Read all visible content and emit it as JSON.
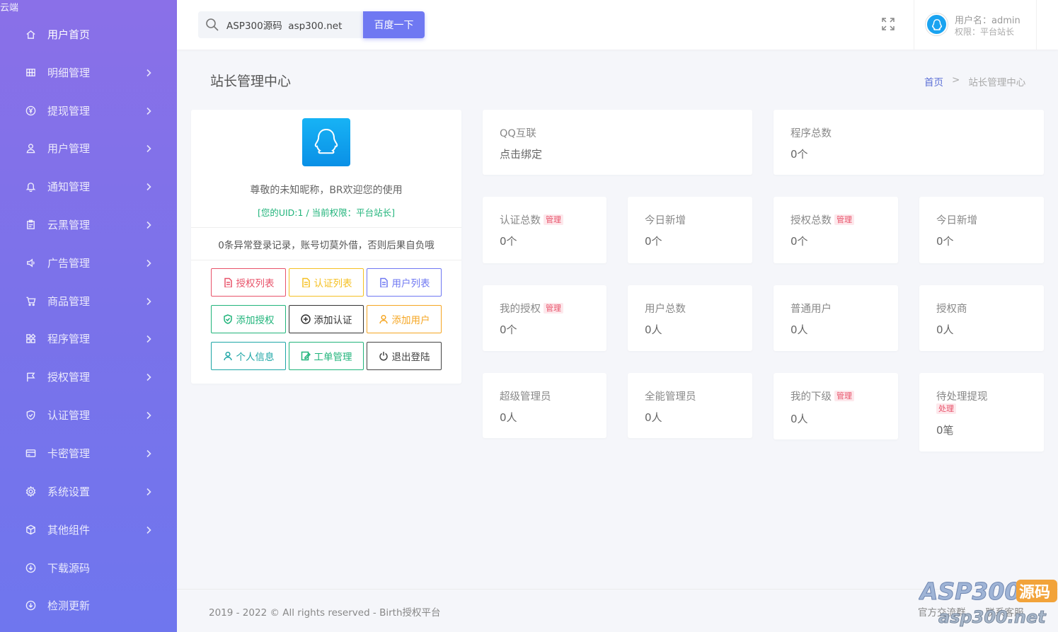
{
  "brand": "云端",
  "sidebar": {
    "items": [
      {
        "label": "用户首页",
        "icon": "home-icon"
      },
      {
        "label": "明细管理",
        "icon": "grid-icon"
      },
      {
        "label": "提现管理",
        "icon": "yen-icon"
      },
      {
        "label": "用户管理",
        "icon": "user-icon"
      },
      {
        "label": "通知管理",
        "icon": "bell-icon"
      },
      {
        "label": "云黑管理",
        "icon": "clipboard-icon"
      },
      {
        "label": "广告管理",
        "icon": "speaker-icon"
      },
      {
        "label": "商品管理",
        "icon": "cart-icon"
      },
      {
        "label": "程序管理",
        "icon": "apps-icon"
      },
      {
        "label": "授权管理",
        "icon": "flag-icon"
      },
      {
        "label": "认证管理",
        "icon": "shield-icon"
      },
      {
        "label": "卡密管理",
        "icon": "card-icon"
      },
      {
        "label": "系统设置",
        "icon": "gear-icon"
      },
      {
        "label": "其他组件",
        "icon": "box-icon"
      },
      {
        "label": "下载源码",
        "icon": "download-icon"
      },
      {
        "label": "检测更新",
        "icon": "update-icon"
      }
    ]
  },
  "header": {
    "search_value": "ASP300源码  asp300.net",
    "search_button": "百度一下",
    "username": "用户名：admin",
    "role": "权限：平台站长"
  },
  "page": {
    "title": "站长管理中心",
    "breadcrumb_home": "首页",
    "breadcrumb_sep": ">",
    "breadcrumb_current": "站长管理中心"
  },
  "profile": {
    "welcome": "尊敬的未知昵称，BR欢迎您的使用",
    "uid_line": "[您的UID:1 / 当前权限：平台站长]",
    "warning": "0条异常登录记录，账号切莫外借，否则后果自负哦",
    "buttons": [
      {
        "label": "授权列表",
        "color": "#e8536a",
        "icon": "doc-icon"
      },
      {
        "label": "认证列表",
        "color": "#f5c023",
        "icon": "doc-icon"
      },
      {
        "label": "用户列表",
        "color": "#6f78f2",
        "icon": "doc-icon"
      },
      {
        "label": "添加授权",
        "color": "#21b47b",
        "icon": "shield-check-icon"
      },
      {
        "label": "添加认证",
        "color": "#333333",
        "icon": "plus-circle-icon"
      },
      {
        "label": "添加用户",
        "color": "#f5a623",
        "icon": "user-icon"
      },
      {
        "label": "个人信息",
        "color": "#1ea6a6",
        "icon": "user-icon"
      },
      {
        "label": "工单管理",
        "color": "#21b47b",
        "icon": "edit-icon"
      },
      {
        "label": "退出登陆",
        "color": "#444444",
        "icon": "power-icon"
      }
    ]
  },
  "stats": {
    "qq": {
      "label": "QQ互联",
      "value": "点击绑定"
    },
    "programs": {
      "label": "程序总数",
      "value": "0个"
    },
    "cert_total": {
      "label": "认证总数",
      "tag": "管理",
      "value": "0个"
    },
    "cert_today": {
      "label": "今日新增",
      "value": "0个"
    },
    "auth_total": {
      "label": "授权总数",
      "tag": "管理",
      "value": "0个"
    },
    "auth_today": {
      "label": "今日新增",
      "value": "0个"
    },
    "my_auth": {
      "label": "我的授权",
      "tag": "管理",
      "value": "0个"
    },
    "user_total": {
      "label": "用户总数",
      "value": "0人"
    },
    "normal_users": {
      "label": "普通用户",
      "value": "0人"
    },
    "agents": {
      "label": "授权商",
      "value": "0人"
    },
    "super_admin": {
      "label": "超级管理员",
      "value": "0人"
    },
    "full_admin": {
      "label": "全能管理员",
      "value": "0人"
    },
    "my_sub": {
      "label": "我的下级",
      "tag": "管理",
      "value": "0人"
    },
    "pending": {
      "label": "待处理提现",
      "tag": "处理",
      "value": "0笔"
    }
  },
  "footer": {
    "copyright": "2019 - 2022 © All rights reserved - Birth授权平台",
    "link1": "官方交流群",
    "link2": "联系客服"
  },
  "watermark": {
    "line1": "ASP300",
    "badge": "源码",
    "line2": "asp300.net"
  }
}
